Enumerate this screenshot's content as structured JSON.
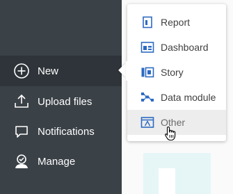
{
  "nav": {
    "items": [
      {
        "label": "New",
        "icon": "plus-circle-icon",
        "active": true
      },
      {
        "label": "Upload files",
        "icon": "upload-icon",
        "active": false
      },
      {
        "label": "Notifications",
        "icon": "chat-bubble-icon",
        "active": false
      },
      {
        "label": "Manage",
        "icon": "manage-user-icon",
        "active": false
      }
    ]
  },
  "new_menu": {
    "items": [
      {
        "label": "Report",
        "icon": "report-icon"
      },
      {
        "label": "Dashboard",
        "icon": "dashboard-icon"
      },
      {
        "label": "Story",
        "icon": "story-icon"
      },
      {
        "label": "Data module",
        "icon": "data-module-icon"
      },
      {
        "label": "Other",
        "icon": "other-icon",
        "hovered": true
      }
    ]
  },
  "colors": {
    "nav_background": "#3a4147",
    "nav_active": "#2e3439",
    "icon_blue": "#2d6ac2",
    "menu_hover": "#ededed",
    "tile_teal": "#e6f6f6"
  }
}
